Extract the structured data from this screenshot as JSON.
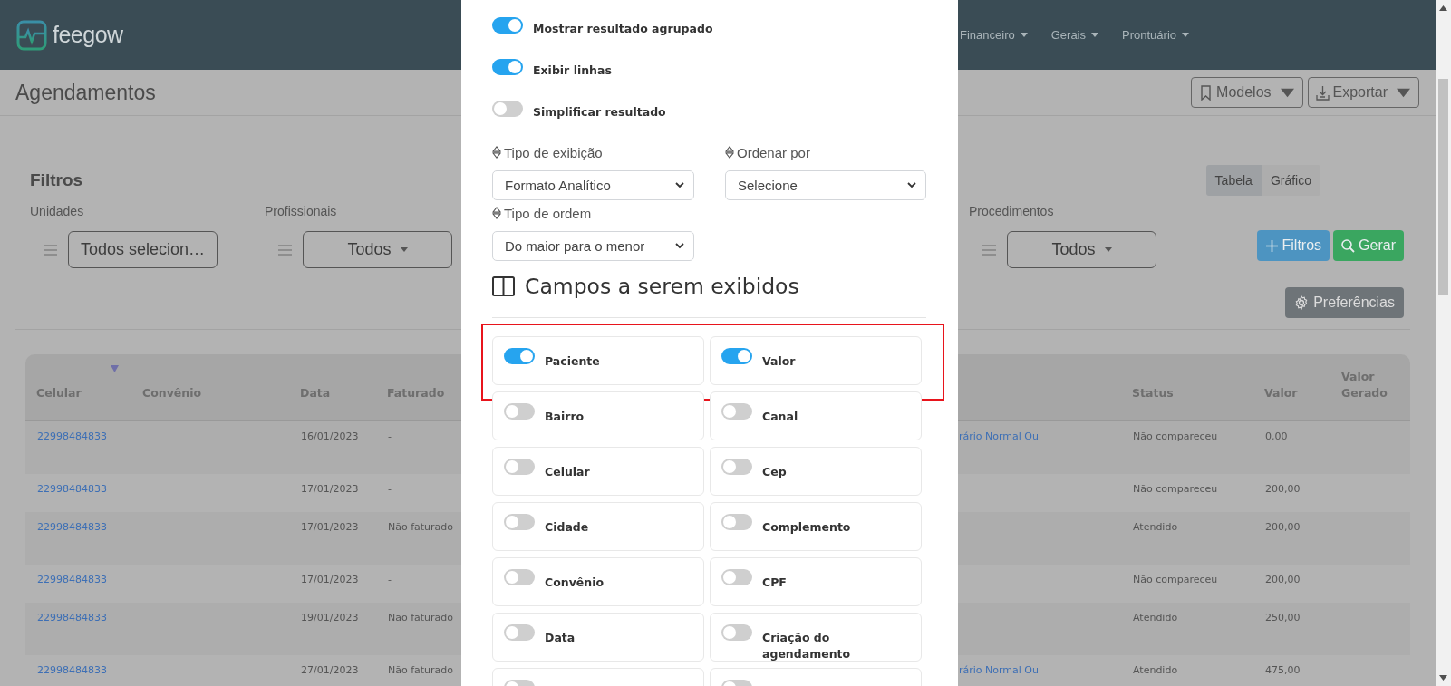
{
  "navbar": {
    "logo": "feegow",
    "menu": [
      {
        "label": "Financeiro"
      },
      {
        "label": "Gerais"
      },
      {
        "label": "Prontuário"
      }
    ]
  },
  "header": {
    "title": "Agendamentos",
    "buttons": [
      {
        "label": "Modelos"
      },
      {
        "label": "Exportar"
      }
    ]
  },
  "filters": {
    "title": "Filtros",
    "view_tabs": [
      {
        "label": "Tabela",
        "selected": true
      },
      {
        "label": "Gráfico",
        "selected": false
      }
    ],
    "groups": [
      {
        "label": "Unidades",
        "value": "Todos selecion…",
        "caret": false
      },
      {
        "label": "Profissionais",
        "value": "Todos",
        "caret": true
      },
      {
        "label": "Procedimentos",
        "value": "Todos",
        "caret": true
      }
    ],
    "actions": [
      {
        "kind": "add",
        "label": "Filtros"
      },
      {
        "kind": "generate",
        "label": "Gerar"
      }
    ],
    "preferences": "Preferências"
  },
  "table": {
    "columns": [
      {
        "label": "Celular",
        "sorted": true
      },
      {
        "label": "Convênio"
      },
      {
        "label": "Data"
      },
      {
        "label": "Faturado"
      },
      {
        "label": "Status"
      },
      {
        "label": "Valor"
      },
      {
        "label": "Valor Gerado"
      }
    ],
    "rows": [
      {
        "celular": "22998484833",
        "data": "16/01/2023",
        "faturado": "-",
        "column_5": "rário Normal Ou",
        "status": "Não compareceu",
        "valor": "0,00"
      },
      {
        "celular": "22998484833",
        "data": "17/01/2023",
        "faturado": "-",
        "status": "Não compareceu",
        "valor": "200,00"
      },
      {
        "celular": "22998484833",
        "data": "17/01/2023",
        "faturado": "Não faturado",
        "status": "Atendido",
        "valor": "200,00"
      },
      {
        "celular": "22998484833",
        "data": "17/01/2023",
        "faturado": "-",
        "status": "Não compareceu",
        "valor": "200,00"
      },
      {
        "celular": "22998484833",
        "data": "19/01/2023",
        "faturado": "Não faturado",
        "status": "Atendido",
        "valor": "250,00"
      },
      {
        "celular": "22998484833",
        "data": "27/01/2023",
        "faturado": "Não faturado",
        "column_5": "rário Normal Ou",
        "status": "Atendido",
        "valor": "475,00"
      }
    ]
  },
  "modal": {
    "options": [
      {
        "label": "Mostrar resultado agrupado",
        "on": true
      },
      {
        "label": "Exibir linhas",
        "on": true
      },
      {
        "label": "Simplificar resultado",
        "on": false
      }
    ],
    "selects": [
      {
        "label": "Tipo de exibição",
        "value": "Formato Analítico"
      },
      {
        "label": "Ordenar por",
        "value": "Selecione"
      },
      {
        "label": "Tipo de ordem",
        "value": "Do maior para o menor"
      }
    ],
    "fields_title": "Campos a serem exibidos",
    "field_rows": [
      {
        "highlighted": true,
        "fields": [
          {
            "label": "Paciente",
            "on": true
          },
          {
            "label": "Valor",
            "on": true
          }
        ]
      },
      {
        "highlighted": false,
        "fields": [
          {
            "label": "Bairro",
            "on": false
          },
          {
            "label": "Canal",
            "on": false
          }
        ]
      },
      {
        "highlighted": false,
        "fields": [
          {
            "label": "Celular",
            "on": false
          },
          {
            "label": "Cep",
            "on": false
          }
        ]
      },
      {
        "highlighted": false,
        "fields": [
          {
            "label": "Cidade",
            "on": false
          },
          {
            "label": "Complemento",
            "on": false
          }
        ]
      },
      {
        "highlighted": false,
        "fields": [
          {
            "label": "Convênio",
            "on": false
          },
          {
            "label": "CPF",
            "on": false
          }
        ]
      },
      {
        "highlighted": false,
        "fields": [
          {
            "label": "Data",
            "on": false
          },
          {
            "label": "Criação do agendamento",
            "on": false
          }
        ]
      },
      {
        "highlighted": false,
        "fields": [
          {
            "on": false
          },
          {
            "on": false
          }
        ]
      }
    ]
  }
}
